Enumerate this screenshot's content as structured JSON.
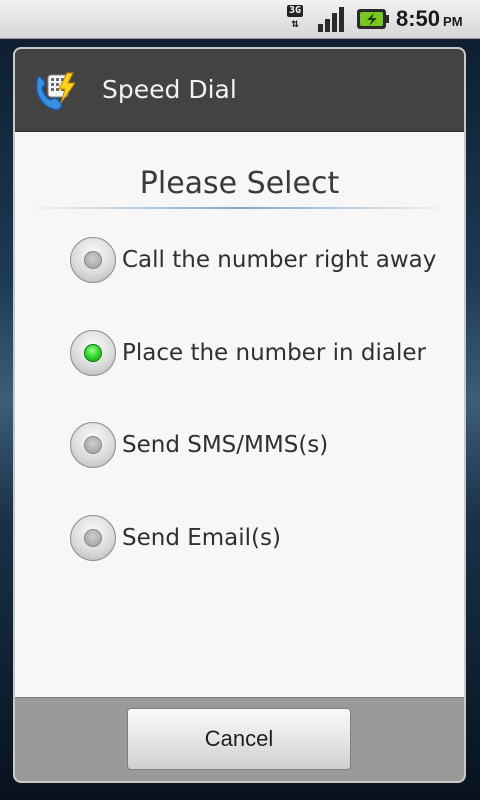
{
  "status_bar": {
    "network_type": "3G",
    "time": "8:50",
    "ampm": "PM",
    "icons": [
      "3g-data-icon",
      "signal-strength-icon",
      "battery-charging-icon"
    ]
  },
  "dialog": {
    "title": "Speed Dial",
    "app_icon": "speed-dial-app-icon",
    "subtitle": "Please Select",
    "options": [
      {
        "label": "Call the number right away",
        "selected": false
      },
      {
        "label": "Place the number in dialer",
        "selected": true
      },
      {
        "label": "Send SMS/MMS(s)",
        "selected": false
      },
      {
        "label": "Send Email(s)",
        "selected": false
      }
    ],
    "cancel_label": "Cancel"
  },
  "colors": {
    "selected_radio": "#2fd62a",
    "header_bg": "#434343",
    "footer_bg": "#9a9a9a"
  }
}
